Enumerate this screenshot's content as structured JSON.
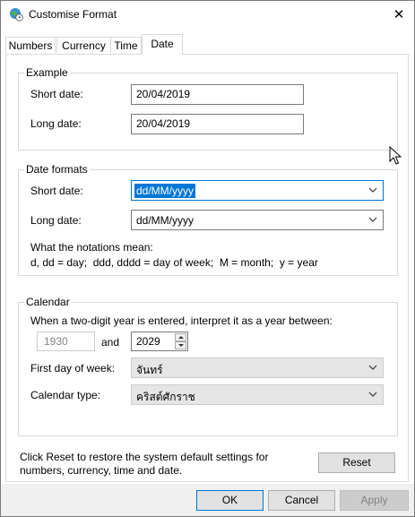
{
  "window": {
    "title": "Customise Format",
    "close_glyph": "✕"
  },
  "tabs": [
    {
      "label": "Numbers",
      "active": false
    },
    {
      "label": "Currency",
      "active": false
    },
    {
      "label": "Time",
      "active": false
    },
    {
      "label": "Date",
      "active": true
    }
  ],
  "example": {
    "group_label": "Example",
    "short_label": "Short date:",
    "short_value": "20/04/2019",
    "long_label": "Long date:",
    "long_value": "20/04/2019"
  },
  "formats": {
    "group_label": "Date formats",
    "short_label": "Short date:",
    "short_value": "dd/MM/yyyy",
    "long_label": "Long date:",
    "long_value": "dd/MM/yyyy",
    "notation_title": "What the notations mean:",
    "notation_text": "d, dd = day;  ddd, dddd = day of week;  M = month;  y = year"
  },
  "calendar": {
    "group_label": "Calendar",
    "two_digit_text": "When a two-digit year is entered, interpret it as a year between:",
    "year_from": "1930",
    "and_label": "and",
    "year_to": "2029",
    "first_day_label": "First day of week:",
    "first_day_value": "จันทร์",
    "type_label": "Calendar type:",
    "type_value": "คริสต์ศักราช"
  },
  "reset": {
    "text": "Click Reset to restore the system default settings for numbers, currency, time and date.",
    "button_label": "Reset"
  },
  "footer": {
    "ok_label": "OK",
    "cancel_label": "Cancel",
    "apply_label": "Apply"
  },
  "colors": {
    "accent": "#0078d7",
    "border": "#7a7a7a",
    "footer_bg": "#f0f0f0"
  },
  "icons": [
    "globe-clock-icon",
    "close-icon",
    "chevron-down-icon",
    "spin-up-icon",
    "spin-down-icon",
    "mouse-cursor-icon"
  ]
}
